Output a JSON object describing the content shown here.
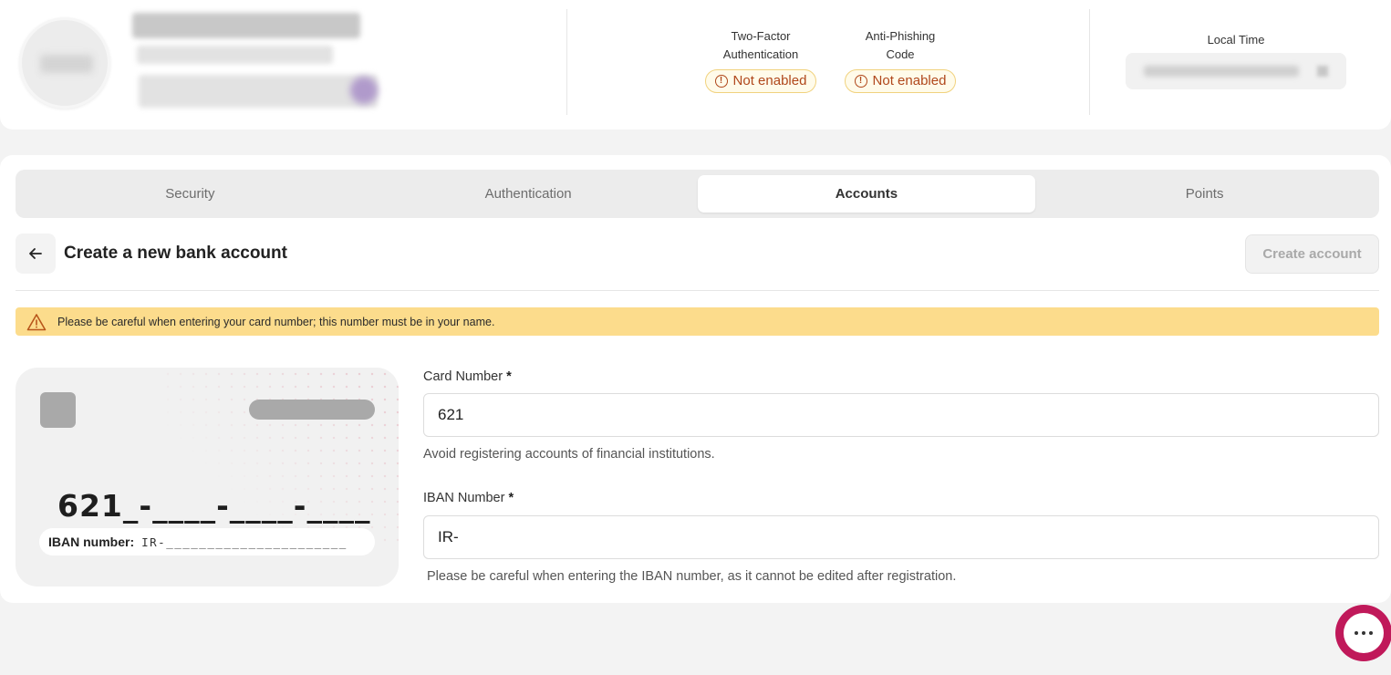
{
  "security_status": {
    "two_factor": {
      "label_line1": "Two-Factor",
      "label_line2": "Authentication",
      "status": "Not enabled"
    },
    "anti_phishing": {
      "label_line1": "Anti-Phishing",
      "label_line2": "Code",
      "status": "Not enabled"
    },
    "local_time_label": "Local Time"
  },
  "tabs": [
    {
      "label": "Security",
      "active": false
    },
    {
      "label": "Authentication",
      "active": false
    },
    {
      "label": "Accounts",
      "active": true
    },
    {
      "label": "Points",
      "active": false
    }
  ],
  "page": {
    "title": "Create a new bank account",
    "create_button": "Create account",
    "warning": "Please be careful when entering your card number; this number must be in your name."
  },
  "card_preview": {
    "number": "621_-____-____-____",
    "iban_label": "IBAN number:",
    "iban_value": "IR-______________________"
  },
  "form": {
    "card_number": {
      "label": "Card Number",
      "required_mark": "*",
      "value": "621",
      "help": "Avoid registering accounts of financial institutions."
    },
    "iban_number": {
      "label": "IBAN Number",
      "required_mark": "*",
      "value": "IR-",
      "help": "Please be careful when entering the IBAN number, as it cannot be edited after registration."
    }
  },
  "colors": {
    "warning_bg": "#fcdc8c",
    "pill_text": "#b0471b",
    "chat_accent": "#c0195a"
  }
}
